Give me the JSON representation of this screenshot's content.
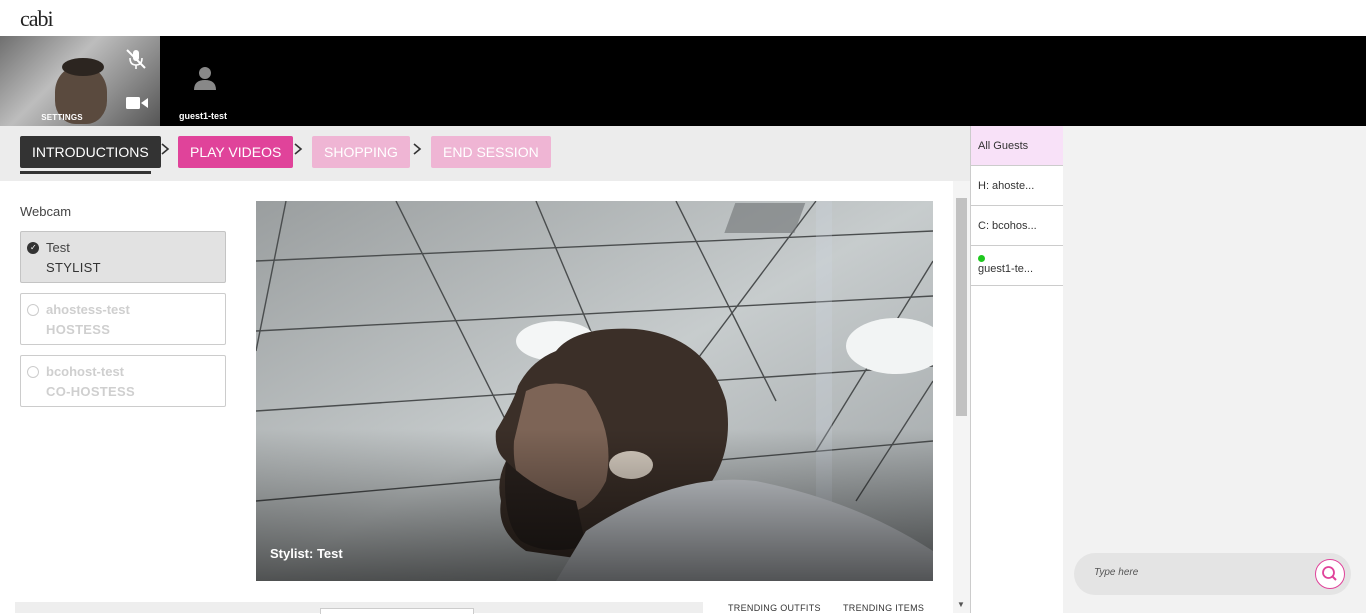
{
  "app": {
    "logo": "cabi"
  },
  "video_strip": {
    "self_label": "SETTINGS",
    "guest_name": "guest1-test"
  },
  "steps": [
    {
      "label": "INTRODUCTIONS",
      "state": "current"
    },
    {
      "label": "PLAY VIDEOS",
      "state": "active"
    },
    {
      "label": "SHOPPING",
      "state": "disabled"
    },
    {
      "label": "END SESSION",
      "state": "disabled"
    }
  ],
  "webcam": {
    "title": "Webcam",
    "people": [
      {
        "name": "Test",
        "role": "STYLIST",
        "selected": true
      },
      {
        "name": "ahostess-test",
        "role": "HOSTESS",
        "selected": false
      },
      {
        "name": "bcohost-test",
        "role": "CO-HOSTESS",
        "selected": false
      }
    ],
    "caption": "Stylist: Test"
  },
  "bottom": {
    "trending_outfits": "TRENDING OUTFITS",
    "trending_items": "TRENDING ITEMS"
  },
  "guests": {
    "items": [
      {
        "label": "All Guests",
        "active": true
      },
      {
        "label": "H: ahoste...",
        "active": false
      },
      {
        "label": "C: bcohos...",
        "active": false
      },
      {
        "label": "guest1-te...",
        "active": false,
        "online": true
      }
    ]
  },
  "chat": {
    "placeholder": "Type here"
  },
  "colors": {
    "accent": "#e0439a",
    "accent_light": "#efb5d4",
    "dark": "#333333",
    "guest_active_bg": "#f8e1f8",
    "online": "#1ec81e"
  }
}
